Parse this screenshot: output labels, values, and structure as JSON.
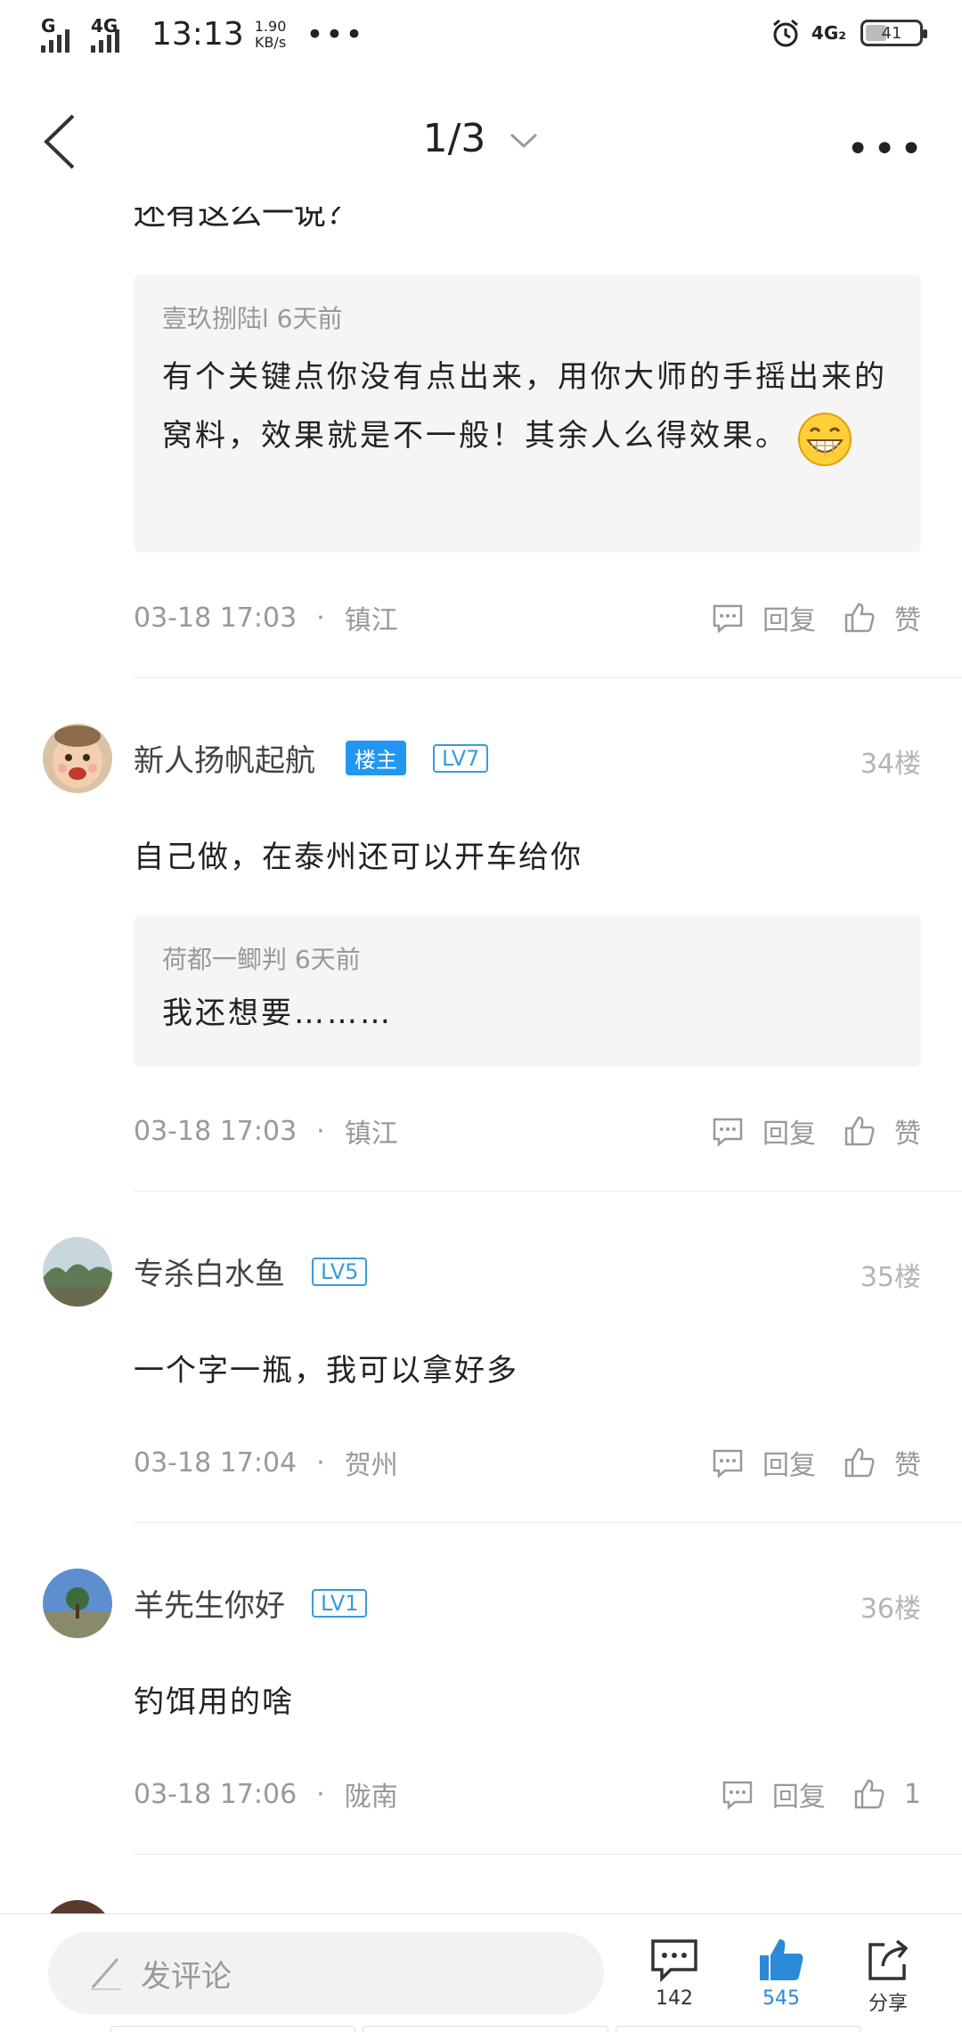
{
  "status_bar": {
    "signal1_label": "G",
    "signal2_label": "4G",
    "time": "13:13",
    "speed_value": "1.90",
    "speed_unit": "KB/s",
    "more_dots": "•••",
    "network": "4G₂",
    "battery": "41"
  },
  "nav": {
    "page_indicator": "1/3",
    "more": "•••"
  },
  "partial_text": "还有这么一说？",
  "thread": [
    {
      "type": "reply_continued",
      "quote": {
        "header": "壹玖捌陆l 6天前",
        "text": "有个关键点你没有点出来，用你大师的手摇出来的窝料，效果就是不一般！其余人么得效果。"
      },
      "time": "03-18 17:03",
      "location": "镇江",
      "reply_label": "回复",
      "like_label": "赞"
    },
    {
      "user": "新人扬帆起航",
      "host_badge": "楼主",
      "level": "LV7",
      "floor": "34楼",
      "text": "自己做，在泰州还可以开车给你",
      "quote": {
        "header": "荷都一鲫判 6天前",
        "text": "我还想要………"
      },
      "time": "03-18 17:03",
      "location": "镇江",
      "reply_label": "回复",
      "like_label": "赞"
    },
    {
      "user": "专杀白水鱼",
      "level": "LV5",
      "floor": "35楼",
      "text": "一个字一瓶，我可以拿好多",
      "time": "03-18 17:04",
      "location": "贺州",
      "reply_label": "回复",
      "like_label": "赞"
    },
    {
      "user": "羊先生你好",
      "level": "LV1",
      "floor": "36楼",
      "text": "钓饵用的啥",
      "time": "03-18 17:06",
      "location": "陇南",
      "reply_label": "回复",
      "like_label": "1"
    }
  ],
  "bottom_bar": {
    "comment_placeholder": "发评论",
    "comments_count": "142",
    "likes_count": "545",
    "share_label": "分享"
  },
  "colors": {
    "accent_blue": "#2196f3",
    "level_badge": "#3a9bdc",
    "muted_text": "#999999",
    "quote_bg": "#f5f5f5"
  }
}
